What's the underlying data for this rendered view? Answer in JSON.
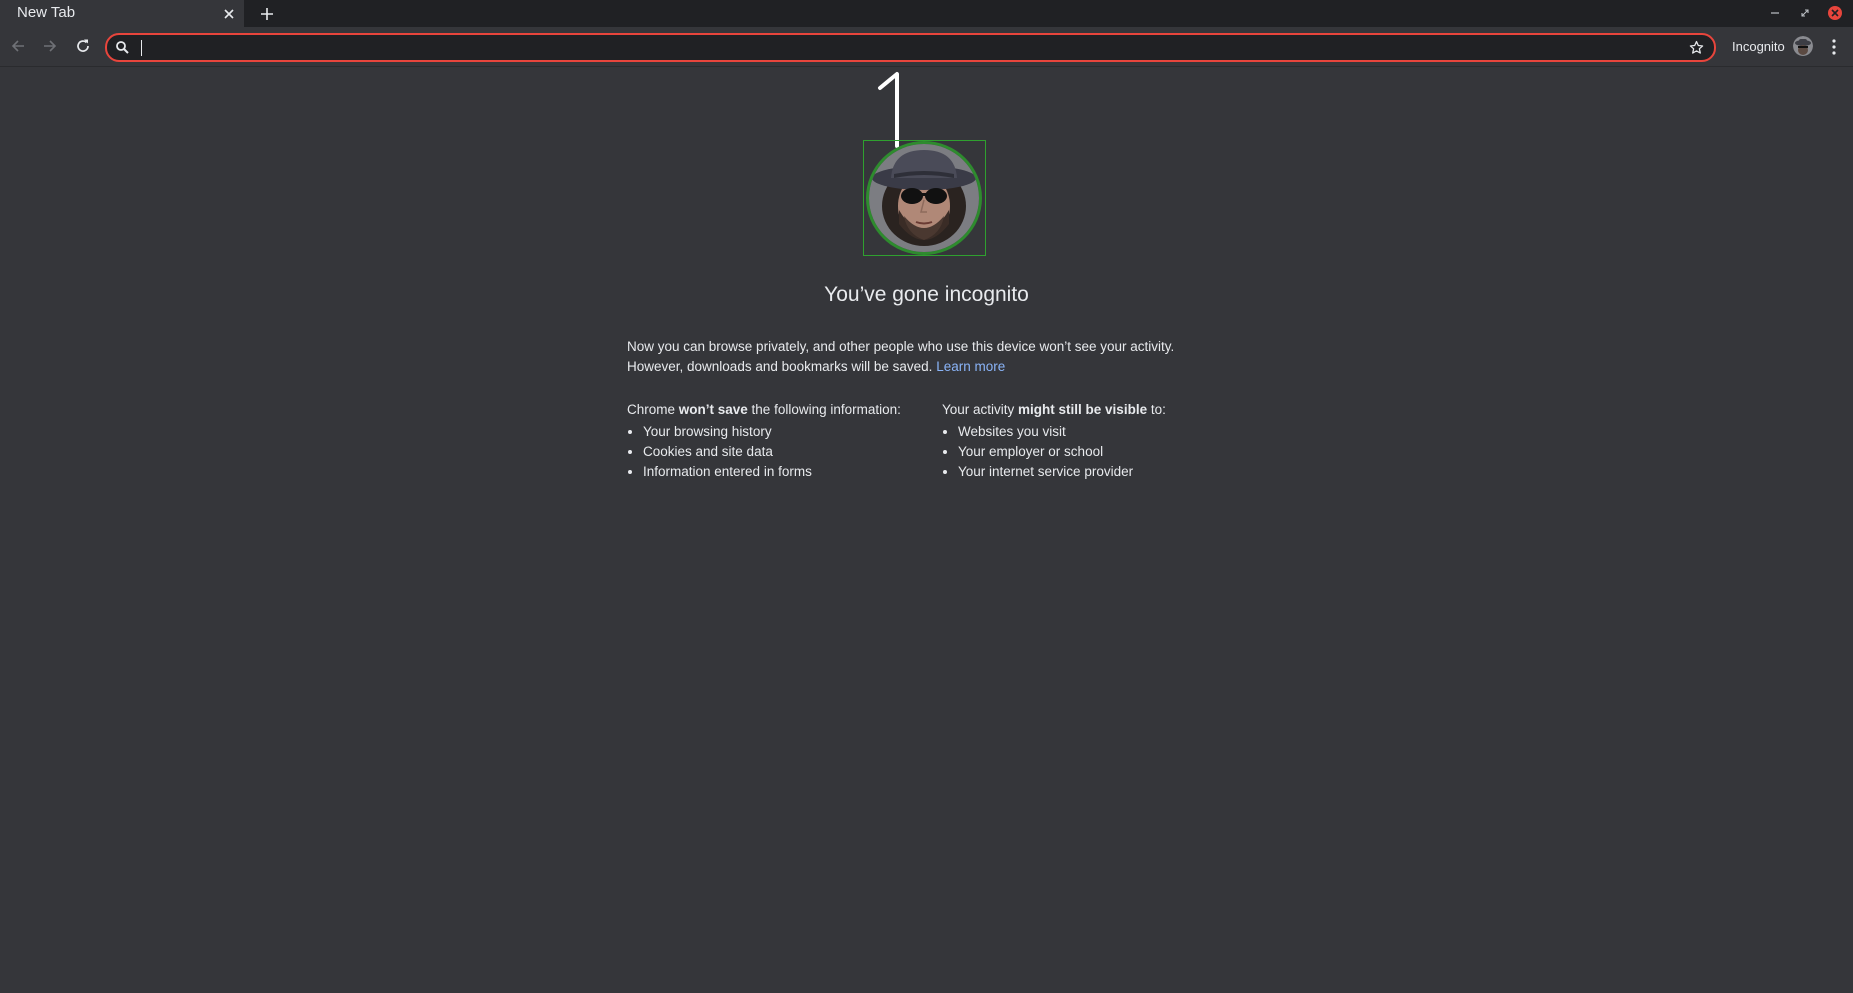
{
  "tab": {
    "title": "New Tab"
  },
  "omnibox": {
    "value": "",
    "placeholder": ""
  },
  "profile": {
    "label": "Incognito"
  },
  "annotation": {
    "marker": "1"
  },
  "content": {
    "heading": "You’ve gone incognito",
    "intro_line1": "Now you can browse privately, and other people who use this device won’t see your activity.",
    "intro_line2": "However, downloads and bookmarks will be saved.",
    "learn_more": "Learn more",
    "left_prefix": "Chrome ",
    "left_bold": "won’t save",
    "left_suffix": " the following information:",
    "left_items": [
      "Your browsing history",
      "Cookies and site data",
      "Information entered in forms"
    ],
    "right_prefix": "Your activity ",
    "right_bold": "might still be visible",
    "right_suffix": " to:",
    "right_items": [
      "Websites you visit",
      "Your employer or school",
      "Your internet service provider"
    ]
  },
  "colors": {
    "omnibox_focus_ring": "#e8453c",
    "close_button": "#e8453c",
    "avatar_ring": "#2e8b2e",
    "link": "#8ab4f8"
  },
  "icons": [
    "close-icon",
    "plus-icon",
    "minimize-icon",
    "restore-icon",
    "window-close-icon",
    "back-arrow-icon",
    "forward-arrow-icon",
    "reload-icon",
    "search-icon",
    "star-icon",
    "kebab-menu-icon"
  ]
}
